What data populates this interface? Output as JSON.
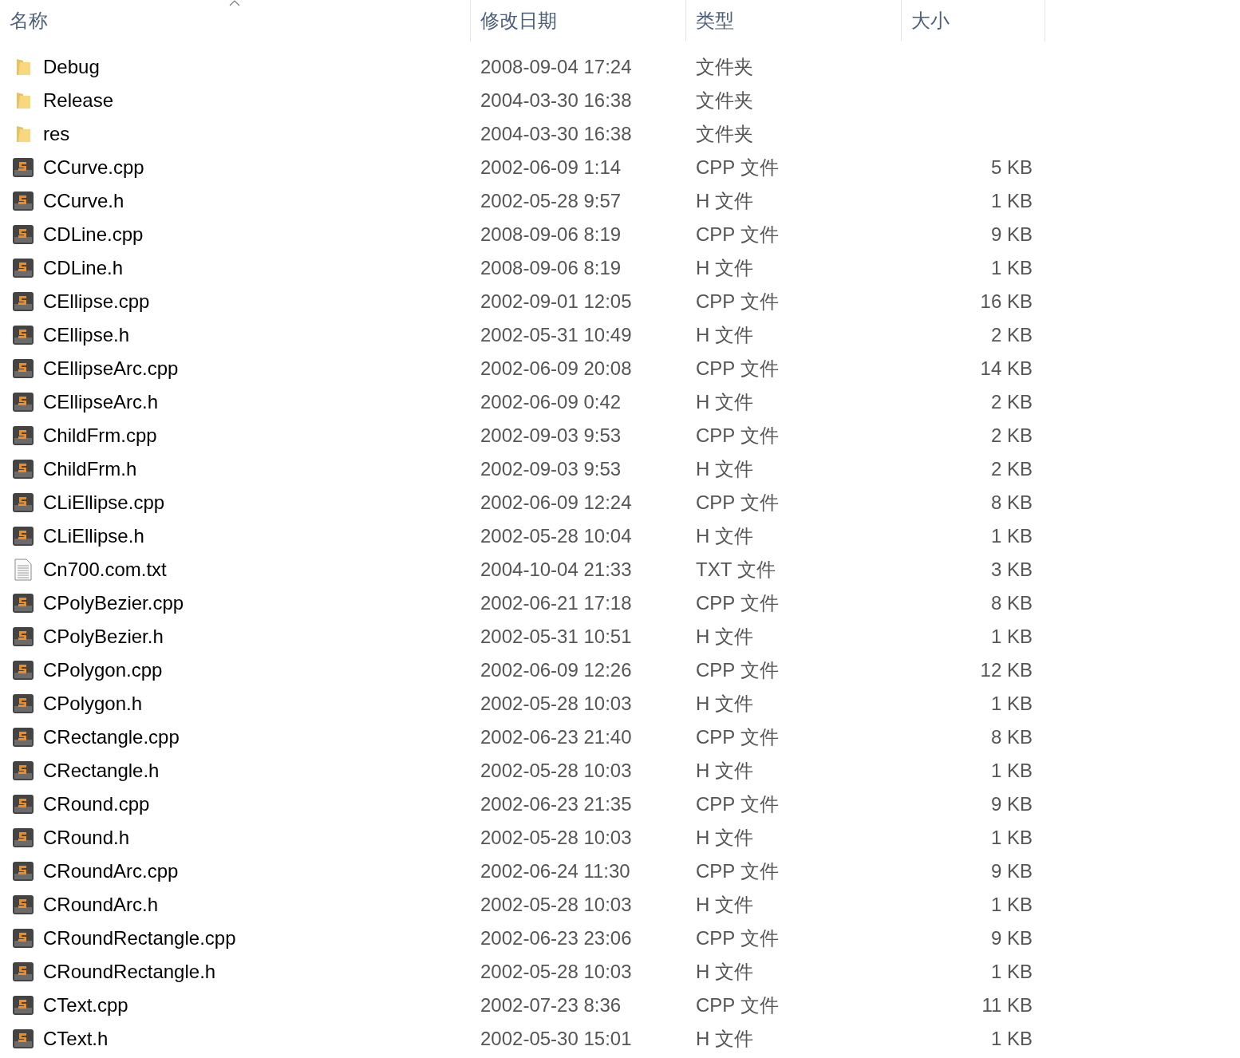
{
  "columns": [
    {
      "label": "名称"
    },
    {
      "label": "修改日期"
    },
    {
      "label": "类型"
    },
    {
      "label": "大小"
    }
  ],
  "files": [
    {
      "name": "Debug",
      "kind": "folder",
      "modified": "2008-09-04 17:24",
      "type": "文件夹"
    },
    {
      "name": "Release",
      "kind": "folder",
      "modified": "2004-03-30 16:38",
      "type": "文件夹"
    },
    {
      "name": "res",
      "kind": "folder",
      "modified": "2004-03-30 16:38",
      "type": "文件夹"
    },
    {
      "name": "CCurve.cpp",
      "kind": "source",
      "modified": "2002-06-09 1:14",
      "type": "CPP 文件",
      "size": "5 KB"
    },
    {
      "name": "CCurve.h",
      "kind": "source",
      "modified": "2002-05-28 9:57",
      "type": "H 文件",
      "size": "1 KB"
    },
    {
      "name": "CDLine.cpp",
      "kind": "source",
      "modified": "2008-09-06 8:19",
      "type": "CPP 文件",
      "size": "9 KB"
    },
    {
      "name": "CDLine.h",
      "kind": "source",
      "modified": "2008-09-06 8:19",
      "type": "H 文件",
      "size": "1 KB"
    },
    {
      "name": "CEllipse.cpp",
      "kind": "source",
      "modified": "2002-09-01 12:05",
      "type": "CPP 文件",
      "size": "16 KB"
    },
    {
      "name": "CEllipse.h",
      "kind": "source",
      "modified": "2002-05-31 10:49",
      "type": "H 文件",
      "size": "2 KB"
    },
    {
      "name": "CEllipseArc.cpp",
      "kind": "source",
      "modified": "2002-06-09 20:08",
      "type": "CPP 文件",
      "size": "14 KB"
    },
    {
      "name": "CEllipseArc.h",
      "kind": "source",
      "modified": "2002-06-09 0:42",
      "type": "H 文件",
      "size": "2 KB"
    },
    {
      "name": "ChildFrm.cpp",
      "kind": "source",
      "modified": "2002-09-03 9:53",
      "type": "CPP 文件",
      "size": "2 KB"
    },
    {
      "name": "ChildFrm.h",
      "kind": "source",
      "modified": "2002-09-03 9:53",
      "type": "H 文件",
      "size": "2 KB"
    },
    {
      "name": "CLiEllipse.cpp",
      "kind": "source",
      "modified": "2002-06-09 12:24",
      "type": "CPP 文件",
      "size": "8 KB"
    },
    {
      "name": "CLiEllipse.h",
      "kind": "source",
      "modified": "2002-05-28 10:04",
      "type": "H 文件",
      "size": "1 KB"
    },
    {
      "name": "Cn700.com.txt",
      "kind": "text",
      "modified": "2004-10-04 21:33",
      "type": "TXT 文件",
      "size": "3 KB"
    },
    {
      "name": "CPolyBezier.cpp",
      "kind": "source",
      "modified": "2002-06-21 17:18",
      "type": "CPP 文件",
      "size": "8 KB"
    },
    {
      "name": "CPolyBezier.h",
      "kind": "source",
      "modified": "2002-05-31 10:51",
      "type": "H 文件",
      "size": "1 KB"
    },
    {
      "name": "CPolygon.cpp",
      "kind": "source",
      "modified": "2002-06-09 12:26",
      "type": "CPP 文件",
      "size": "12 KB"
    },
    {
      "name": "CPolygon.h",
      "kind": "source",
      "modified": "2002-05-28 10:03",
      "type": "H 文件",
      "size": "1 KB"
    },
    {
      "name": "CRectangle.cpp",
      "kind": "source",
      "modified": "2002-06-23 21:40",
      "type": "CPP 文件",
      "size": "8 KB"
    },
    {
      "name": "CRectangle.h",
      "kind": "source",
      "modified": "2002-05-28 10:03",
      "type": "H 文件",
      "size": "1 KB"
    },
    {
      "name": "CRound.cpp",
      "kind": "source",
      "modified": "2002-06-23 21:35",
      "type": "CPP 文件",
      "size": "9 KB"
    },
    {
      "name": "CRound.h",
      "kind": "source",
      "modified": "2002-05-28 10:03",
      "type": "H 文件",
      "size": "1 KB"
    },
    {
      "name": "CRoundArc.cpp",
      "kind": "source",
      "modified": "2002-06-24 11:30",
      "type": "CPP 文件",
      "size": "9 KB"
    },
    {
      "name": "CRoundArc.h",
      "kind": "source",
      "modified": "2002-05-28 10:03",
      "type": "H 文件",
      "size": "1 KB"
    },
    {
      "name": "CRoundRectangle.cpp",
      "kind": "source",
      "modified": "2002-06-23 23:06",
      "type": "CPP 文件",
      "size": "9 KB"
    },
    {
      "name": "CRoundRectangle.h",
      "kind": "source",
      "modified": "2002-05-28 10:03",
      "type": "H 文件",
      "size": "1 KB"
    },
    {
      "name": "CText.cpp",
      "kind": "source",
      "modified": "2002-07-23 8:36",
      "type": "CPP 文件",
      "size": "11 KB"
    },
    {
      "name": "CText.h",
      "kind": "source",
      "modified": "2002-05-30 15:01",
      "type": "H 文件",
      "size": "1 KB"
    }
  ]
}
